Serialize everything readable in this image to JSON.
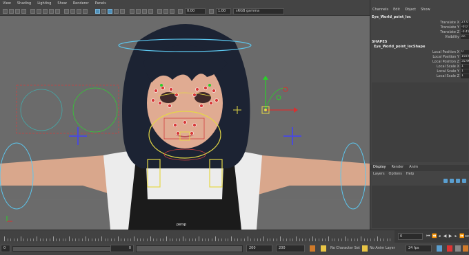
{
  "menubar": [
    "View",
    "Shading",
    "Lighting",
    "Show",
    "Renderer",
    "Panels"
  ],
  "toolbar": {
    "field1": "0.00",
    "field2": "1.00",
    "colorspace": "sRGB gamma"
  },
  "viewport": {
    "camera_label": "persp"
  },
  "channel_box": {
    "tabs": [
      "Channels",
      "Edit",
      "Object",
      "Show"
    ],
    "node_name": "Eye_World_point_loc",
    "attributes": [
      {
        "label": "Translate X",
        "value": "27.0"
      },
      {
        "label": "Translate Y",
        "value": "-0.0"
      },
      {
        "label": "Translate Z",
        "value": "-0.45"
      },
      {
        "label": "Visibility",
        "value": "on"
      }
    ],
    "shapes_header": "SHAPES",
    "shape_name": "Eye_World_point_locShape",
    "shape_attributes": [
      {
        "label": "Local Position X",
        "value": "0"
      },
      {
        "label": "Local Position Y",
        "value": "159.0"
      },
      {
        "label": "Local Position Z",
        "value": "35.96"
      },
      {
        "label": "Local Scale X",
        "value": "1"
      },
      {
        "label": "Local Scale Y",
        "value": "1"
      },
      {
        "label": "Local Scale Z",
        "value": "1"
      }
    ]
  },
  "layer_editor": {
    "tabs": [
      "Display",
      "Render",
      "Anim"
    ],
    "menu": [
      "Layers",
      "Options",
      "Help"
    ]
  },
  "timeline": {
    "current_frame": "0"
  },
  "range_slider": {
    "start_field": "0",
    "inner_start": "0",
    "inner_end": "200",
    "end_field_1": "200",
    "end_field_2": "200",
    "character_set": "No Character Set",
    "anim_layer": "No Anim Layer",
    "fps": "24 fps"
  },
  "colors": {
    "accent": "#4f8fb8",
    "viewport_bg": "#6b6b6b",
    "panel_bg": "#444444"
  }
}
